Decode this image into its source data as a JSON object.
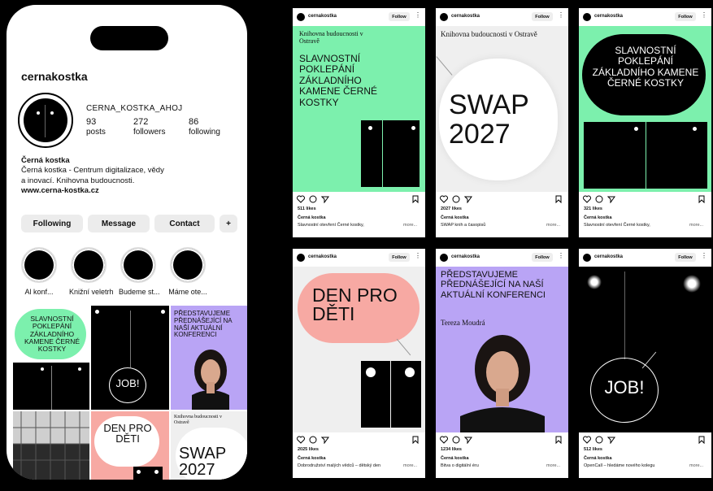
{
  "profile": {
    "username": "cernakostka",
    "handle": "CERNA_KOSTKA_AHOJ",
    "posts": "93",
    "posts_label": "posts",
    "followers": "272",
    "followers_label": "followers",
    "following": "86",
    "following_label": "following",
    "bio_name": "Černá kostka",
    "bio_line1": "Černá kostka - Centrum digitalizace, vědy",
    "bio_line2": "a inovací. Knihovna budoucnosti.",
    "bio_link": "www.cerna-kostka.cz",
    "btn_following": "Following",
    "btn_message": "Message",
    "btn_contact": "Contact",
    "btn_add": "+",
    "highlights": [
      "Al konf...",
      "Knižní veletrh",
      "Budeme st...",
      "Máme ote..."
    ]
  },
  "grid": {
    "t1_text": "SLAVNOSTNÍ POKLEPÁNÍ ZÁKLADNÍHO KAMENE ČERNÉ KOSTKY",
    "t2_text": "JOB!",
    "t3_text": "PŘEDSTAVUJEME PŘEDNÁŠEJÍCÍ NA NAŠÍ AKTUÁLNÍ KONFERENCI",
    "t5_text": "DEN PRO DĚTI",
    "t6_small": "Knihovna budoucnosti v Ostravě",
    "t6_text": "SWAP 2027"
  },
  "common": {
    "user": "cernakostka",
    "follow": "Follow",
    "more": "more...",
    "name": "Černá kostka"
  },
  "posts": [
    {
      "serif": "Knihovna budoucnosti v Ostravě",
      "headline": "SLAVNOSTNÍ POKLEPÁNÍ ZÁKLADNÍHO KAMENE ČERNÉ KOSTKY",
      "likes": "511 likes",
      "caption": "Slavnostní otevření Černé kostky,"
    },
    {
      "serif": "Knihovna budoucnosti v Ostravě",
      "headline": "SWAP 2027",
      "likes": "2027 likes",
      "caption": "SWAP knih a časopisů"
    },
    {
      "headline": "SLAVNOSTNÍ POKLEPÁNÍ ZÁKLADNÍHO KAMENE ČERNÉ KOSTKY",
      "likes": "321 likes",
      "caption": "Slavnostní otevření Černé kostky,"
    },
    {
      "headline": "DEN PRO DĚTI",
      "likes": "2025 likes",
      "caption": "Dobrodružství malých vědců – dětský den"
    },
    {
      "headline": "PŘEDSTAVUJEME PŘEDNÁŠEJÍCÍ NA NAŠÍ AKTUÁLNÍ KONFERENCI",
      "serif": "Tereza Moudrá",
      "likes": "1234 likes",
      "caption": "Bitva o digitální éru"
    },
    {
      "headline": "JOB!",
      "likes": "512 likes",
      "caption": "OpenCall – hledáme nového kolegu"
    }
  ],
  "colors": {
    "mint": "#7cf0ad",
    "lilac": "#b9a4f5",
    "pink": "#f7a9a3",
    "black": "#000000",
    "grey": "#efefef"
  }
}
